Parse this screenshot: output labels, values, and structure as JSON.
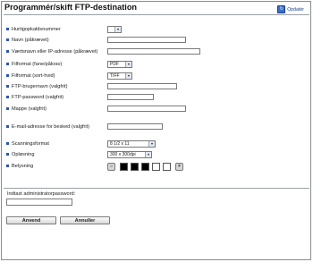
{
  "page": {
    "title": "Programmér/skift FTP-destination",
    "refresh_label": "Opdatér"
  },
  "form": {
    "fields": {
      "shortcut": "Hurtigopkaldsnummer",
      "name": "Navn (påkrævet)",
      "host": "Værtsnavn eller IP-adresse (påkrævet)",
      "file_format_single_multi": "Filformat (fane/påkrav)",
      "file_format_single": "Filformat (sort-hvid)",
      "ftp_username": "FTP-brugernavn (valgfrit)",
      "ftp_password": "FTP-password (valgfrit)",
      "folder": "Mappe (valgfrit)",
      "email_notification": "E-mail-adresse for besked (valgfrit)",
      "scan_format": "Scanningsformat",
      "resolution": "Opløsning",
      "exposure": "Belysning"
    },
    "values": {
      "file_format_single_multi": "PDF",
      "file_format_single": "TIFF",
      "scan_format": "8 1/2 x 11",
      "resolution": "300 x 300dpi"
    }
  },
  "admin": {
    "prompt": "Indtast administratorpassword:"
  },
  "buttons": {
    "apply": "Anvend",
    "cancel": "Annuller"
  },
  "icons": {
    "refresh": "refresh-icon",
    "exposure_lighter": "exposure-lighter-icon",
    "exposure_darker": "exposure-darker-icon"
  },
  "colors": {
    "bullet": "#2a56a8",
    "link": "#1b3f8f"
  }
}
